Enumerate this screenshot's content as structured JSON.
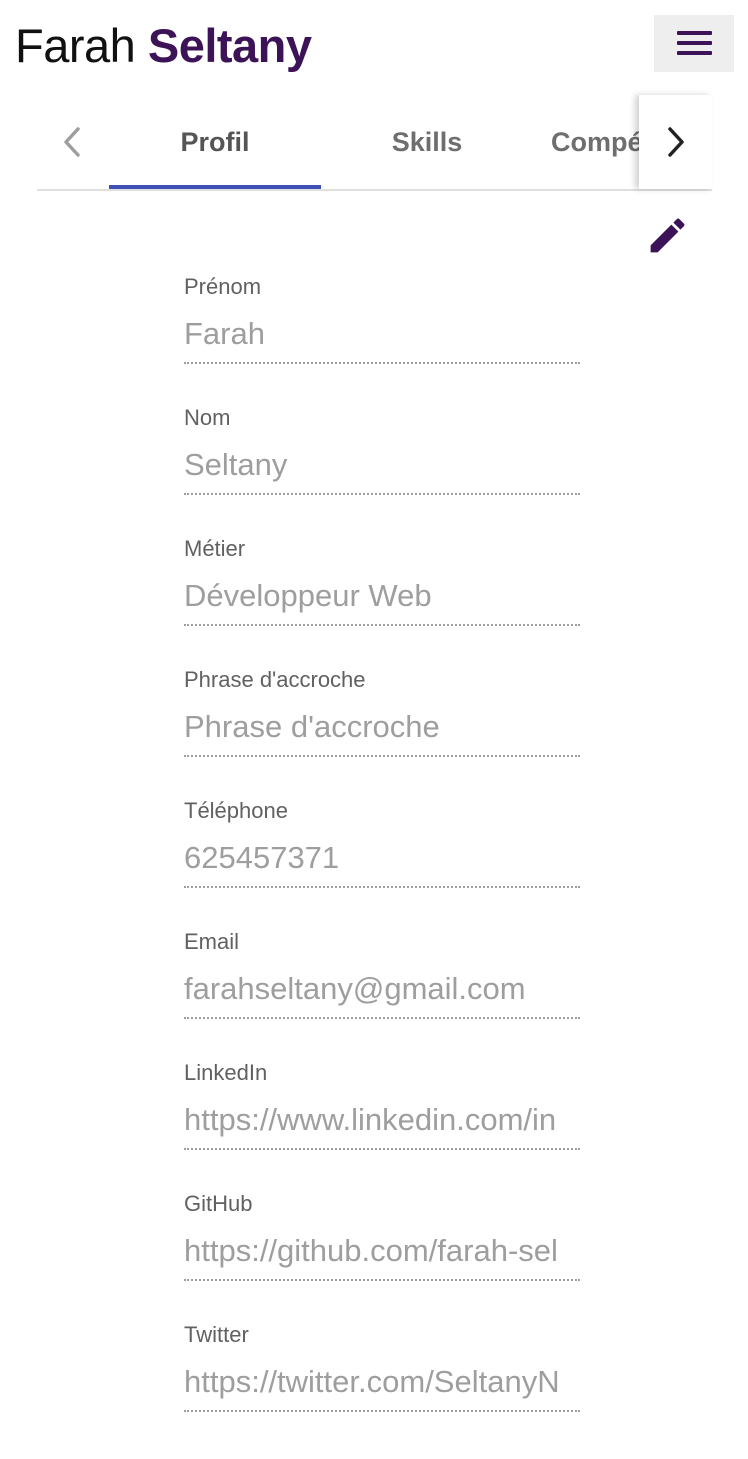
{
  "header": {
    "first_name": "Farah",
    "last_name": "Seltany",
    "menu_icon": "menu-icon"
  },
  "tabs": {
    "items": [
      {
        "label": "Profil",
        "active": true
      },
      {
        "label": "Skills",
        "active": false
      },
      {
        "label": "Compé",
        "active": false
      }
    ],
    "prev_icon": "chevron-left-icon",
    "next_icon": "chevron-right-icon",
    "indicator_color": "#3f51b5"
  },
  "edit_icon": "pencil-icon",
  "fields": [
    {
      "label": "Prénom",
      "value": "Farah"
    },
    {
      "label": "Nom",
      "value": "Seltany"
    },
    {
      "label": "Métier",
      "value": "Développeur Web"
    },
    {
      "label": "Phrase d'accroche",
      "value": "Phrase d'accroche"
    },
    {
      "label": "Téléphone",
      "value": "625457371"
    },
    {
      "label": "Email",
      "value": "farahseltany@gmail.com"
    },
    {
      "label": "LinkedIn",
      "value": "https://www.linkedin.com/in"
    },
    {
      "label": "GitHub",
      "value": "https://github.com/farah-sel"
    },
    {
      "label": "Twitter",
      "value": "https://twitter.com/SeltanyN"
    }
  ],
  "colors": {
    "brand_accent": "#3d1357",
    "label": "#616161",
    "value": "#9e9e9e"
  }
}
